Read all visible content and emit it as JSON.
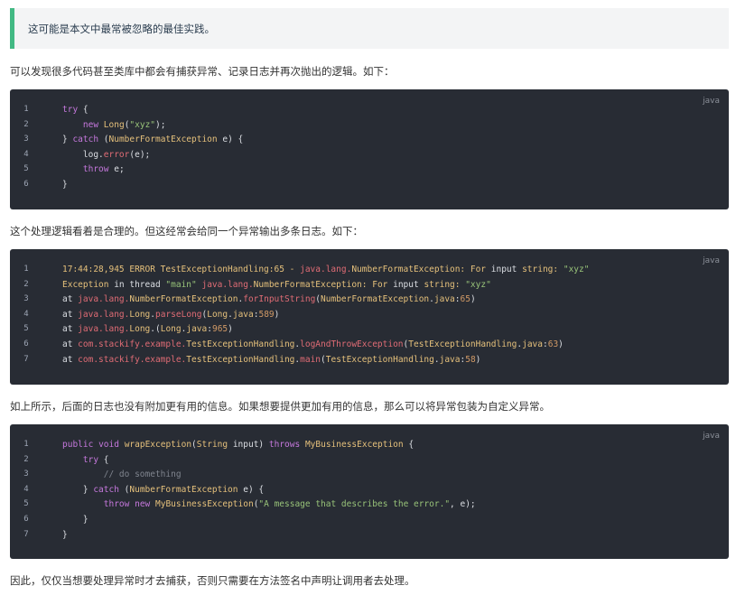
{
  "callout": {
    "text": "这可能是本文中最常被忽略的最佳实践。"
  },
  "paragraphs": [
    "可以发现很多代码甚至类库中都会有捕获异常、记录日志并再次抛出的逻辑。如下：",
    "这个处理逻辑看着是合理的。但这经常会给同一个异常输出多条日志。如下：",
    "如上所示，后面的日志也没有附加更有用的信息。如果想要提供更加有用的信息，那么可以将异常包装为自定义异常。",
    "因此，仅仅当想要处理异常时才去捕获，否则只需要在方法签名中声明让调用者去处理。"
  ],
  "code_blocks": [
    {
      "lang": "java",
      "lines": [
        [
          [
            "try",
            "kw"
          ],
          [
            " {",
            "pl"
          ]
        ],
        [
          [
            "    ",
            "pl"
          ],
          [
            "new",
            "kw"
          ],
          [
            " ",
            "pl"
          ],
          [
            "Long",
            "ty"
          ],
          [
            "(",
            "pl"
          ],
          [
            "\"xyz\"",
            "st"
          ],
          [
            ");",
            "pl"
          ]
        ],
        [
          [
            "} ",
            "pl"
          ],
          [
            "catch",
            "kw"
          ],
          [
            " (",
            "pl"
          ],
          [
            "NumberFormatException",
            "ty"
          ],
          [
            " e) {",
            "pl"
          ]
        ],
        [
          [
            "    log.",
            "pl"
          ],
          [
            "error",
            "fn"
          ],
          [
            "(e);",
            "pl"
          ]
        ],
        [
          [
            "    ",
            "pl"
          ],
          [
            "throw",
            "kw"
          ],
          [
            " e;",
            "pl"
          ]
        ],
        [
          [
            "}",
            "pl"
          ]
        ]
      ]
    },
    {
      "lang": "java",
      "lines": [
        [
          [
            "17:44:28,945 ERROR TestExceptionHandling:65 - ",
            "ty"
          ],
          [
            "java.lang.",
            "fn"
          ],
          [
            "NumberFormatException",
            "ty"
          ],
          [
            ": For ",
            "ty"
          ],
          [
            "input",
            "pl"
          ],
          [
            " string: ",
            "ty"
          ],
          [
            "\"xyz\"",
            "st"
          ]
        ],
        [
          [
            "Exception",
            "ty"
          ],
          [
            " in thread ",
            "pl"
          ],
          [
            "\"main\"",
            "st"
          ],
          [
            " ",
            "pl"
          ],
          [
            "java.lang.",
            "fn"
          ],
          [
            "NumberFormatException",
            "ty"
          ],
          [
            ": For ",
            "ty"
          ],
          [
            "input",
            "pl"
          ],
          [
            " string: ",
            "ty"
          ],
          [
            "\"xyz\"",
            "st"
          ]
        ],
        [
          [
            "at ",
            "pl"
          ],
          [
            "java.lang.",
            "fn"
          ],
          [
            "NumberFormatException",
            "ty"
          ],
          [
            ".",
            "pl"
          ],
          [
            "forInputString",
            "fn"
          ],
          [
            "(",
            "pl"
          ],
          [
            "NumberFormatException",
            "ty"
          ],
          [
            ".",
            "pl"
          ],
          [
            "java",
            "ty"
          ],
          [
            ":",
            "pl"
          ],
          [
            "65",
            "nm"
          ],
          [
            ")",
            "pl"
          ]
        ],
        [
          [
            "at ",
            "pl"
          ],
          [
            "java.lang.",
            "fn"
          ],
          [
            "Long",
            "ty"
          ],
          [
            ".",
            "pl"
          ],
          [
            "parseLong",
            "fn"
          ],
          [
            "(",
            "pl"
          ],
          [
            "Long",
            "ty"
          ],
          [
            ".",
            "pl"
          ],
          [
            "java",
            "ty"
          ],
          [
            ":",
            "pl"
          ],
          [
            "589",
            "nm"
          ],
          [
            ")",
            "pl"
          ]
        ],
        [
          [
            "at ",
            "pl"
          ],
          [
            "java.lang.",
            "fn"
          ],
          [
            "Long",
            "ty"
          ],
          [
            ".(",
            "pl"
          ],
          [
            "Long",
            "ty"
          ],
          [
            ".",
            "pl"
          ],
          [
            "java",
            "ty"
          ],
          [
            ":",
            "pl"
          ],
          [
            "965",
            "nm"
          ],
          [
            ")",
            "pl"
          ]
        ],
        [
          [
            "at ",
            "pl"
          ],
          [
            "com.stackify.example.",
            "fn"
          ],
          [
            "TestExceptionHandling",
            "ty"
          ],
          [
            ".",
            "pl"
          ],
          [
            "logAndThrowException",
            "fn"
          ],
          [
            "(",
            "pl"
          ],
          [
            "TestExceptionHandling",
            "ty"
          ],
          [
            ".",
            "pl"
          ],
          [
            "java",
            "ty"
          ],
          [
            ":",
            "pl"
          ],
          [
            "63",
            "nm"
          ],
          [
            ")",
            "pl"
          ]
        ],
        [
          [
            "at ",
            "pl"
          ],
          [
            "com.stackify.example.",
            "fn"
          ],
          [
            "TestExceptionHandling",
            "ty"
          ],
          [
            ".",
            "pl"
          ],
          [
            "main",
            "fn"
          ],
          [
            "(",
            "pl"
          ],
          [
            "TestExceptionHandling",
            "ty"
          ],
          [
            ".",
            "pl"
          ],
          [
            "java",
            "ty"
          ],
          [
            ":",
            "pl"
          ],
          [
            "58",
            "nm"
          ],
          [
            ")",
            "pl"
          ]
        ]
      ]
    },
    {
      "lang": "java",
      "lines": [
        [
          [
            "public",
            "kw"
          ],
          [
            " ",
            "pl"
          ],
          [
            "void",
            "kw"
          ],
          [
            " ",
            "pl"
          ],
          [
            "wrapException",
            "ty"
          ],
          [
            "(",
            "pl"
          ],
          [
            "String",
            "ty"
          ],
          [
            " input) ",
            "pl"
          ],
          [
            "throws",
            "kw"
          ],
          [
            " ",
            "pl"
          ],
          [
            "MyBusinessException",
            "ty"
          ],
          [
            " {",
            "pl"
          ]
        ],
        [
          [
            "    ",
            "pl"
          ],
          [
            "try",
            "kw"
          ],
          [
            " {",
            "pl"
          ]
        ],
        [
          [
            "        ",
            "pl"
          ],
          [
            "// do something",
            "cm"
          ]
        ],
        [
          [
            "    } ",
            "pl"
          ],
          [
            "catch",
            "kw"
          ],
          [
            " (",
            "pl"
          ],
          [
            "NumberFormatException",
            "ty"
          ],
          [
            " e) {",
            "pl"
          ]
        ],
        [
          [
            "        ",
            "pl"
          ],
          [
            "throw",
            "kw"
          ],
          [
            " ",
            "pl"
          ],
          [
            "new",
            "kw"
          ],
          [
            " ",
            "pl"
          ],
          [
            "MyBusinessException",
            "ty"
          ],
          [
            "(",
            "pl"
          ],
          [
            "\"A message that describes the error.\"",
            "st"
          ],
          [
            ", e);",
            "pl"
          ]
        ],
        [
          [
            "    }",
            "pl"
          ]
        ],
        [
          [
            "}",
            "pl"
          ]
        ]
      ]
    }
  ]
}
